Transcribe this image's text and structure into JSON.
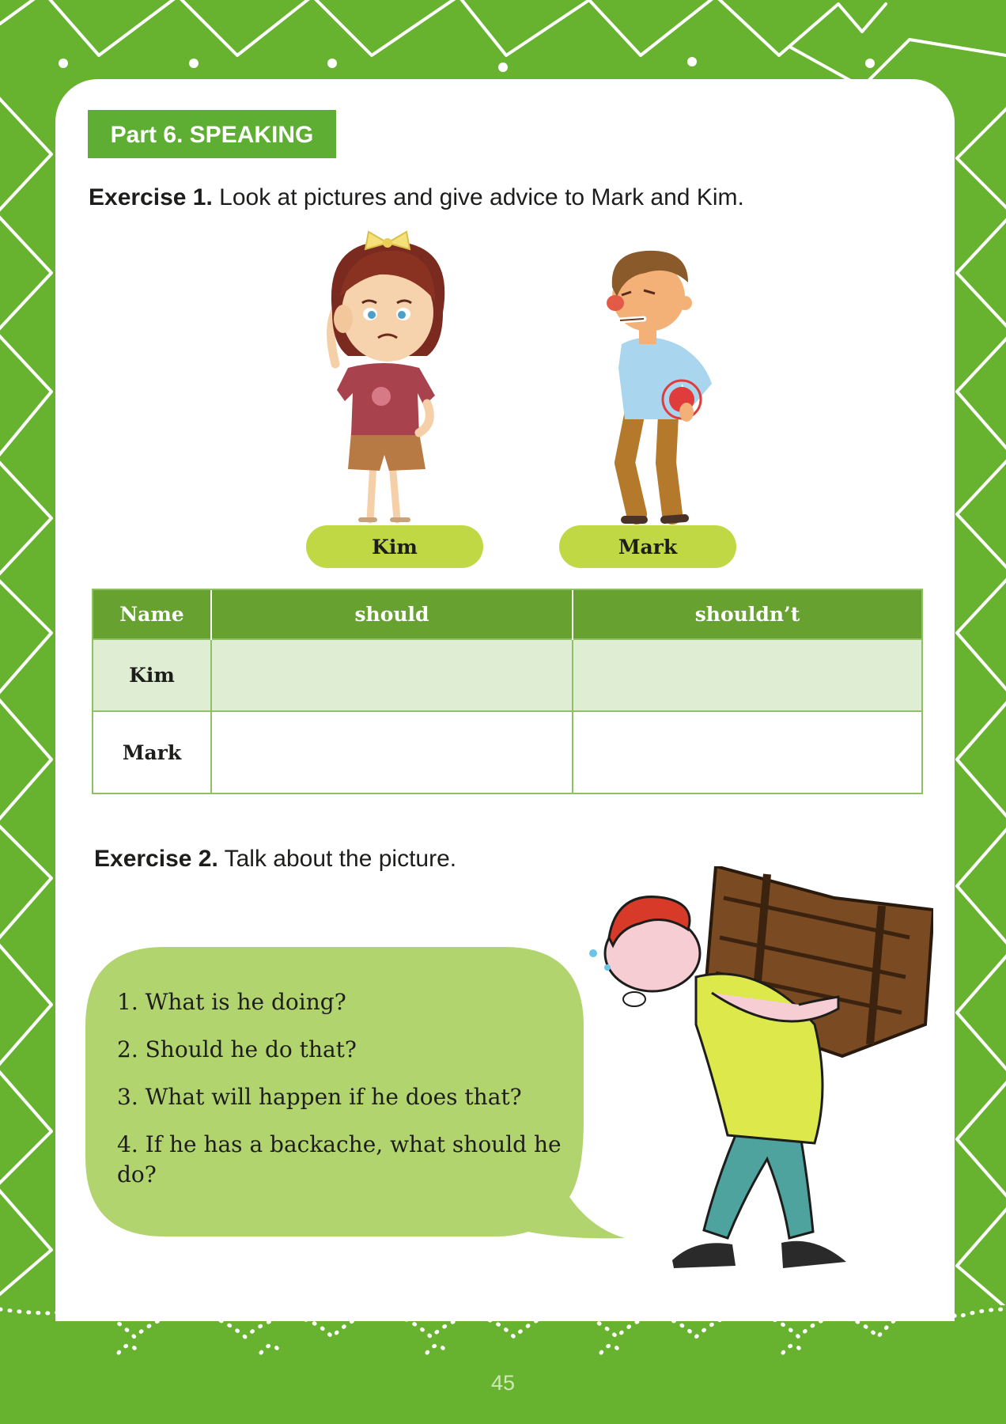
{
  "part_heading": "Part 6. SPEAKING",
  "exercise1": {
    "label": "Exercise 1.",
    "instruction": "Look at pictures and give advice to Mark and Kim."
  },
  "characters": [
    "Kim",
    "Mark"
  ],
  "advice_table": {
    "headers": [
      "Name",
      "should",
      "shouldn’t"
    ],
    "rows": [
      {
        "name": "Kim",
        "should": "",
        "shouldnt": ""
      },
      {
        "name": "Mark",
        "should": "",
        "shouldnt": ""
      }
    ]
  },
  "exercise2": {
    "label": "Exercise 2.",
    "instruction": "Talk about the picture.",
    "questions": [
      "1. What is he doing?",
      "2. Should he do that?",
      "3. What will happen if he does that?",
      "4. If he has a backache, what should he do?"
    ]
  },
  "page_number": "45",
  "colors": {
    "background_green": "#67b22f",
    "heading_green": "#5fae34",
    "pill_lime": "#c0d844",
    "table_header": "#67a230",
    "table_row_tint": "#dfedd2",
    "bubble_green": "#b2d46f"
  }
}
